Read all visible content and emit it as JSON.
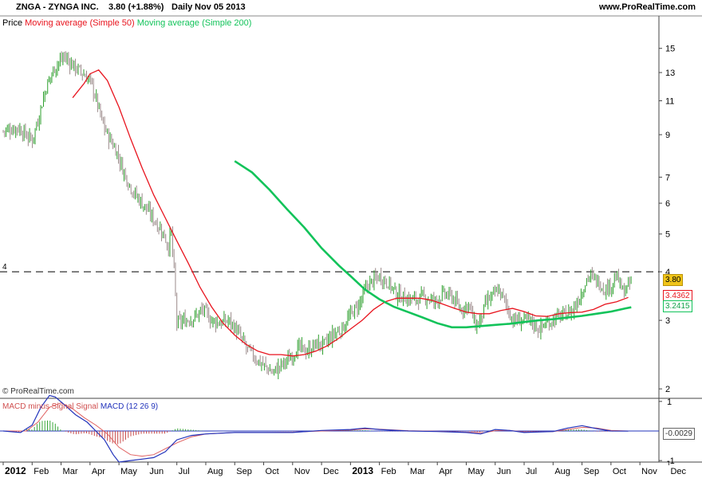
{
  "header": {
    "symbol_text": "ZNGA - ZYNGA INC.",
    "quote_text": "3.80 (+1.88%)",
    "period_text": "Daily",
    "date_text": "Nov 05 2013",
    "site_text": "www.ProRealTime.com"
  },
  "legend": {
    "price": "Price",
    "ma50": "Moving average (Simple 50)",
    "ma200": "Moving average (Simple 200)"
  },
  "macd_legend": {
    "histogram": "MACD minus Signal",
    "signal": "Signal",
    "macd": "MACD (12 26 9)"
  },
  "copyright": "© ProRealTime.com",
  "colors": {
    "up": "#2ea02e",
    "down": "#9b8a8a",
    "ma50": "#e8141e",
    "ma200": "#12c35a",
    "macd": "#2233bb",
    "signal": "#e06060",
    "price_badge": "#f0c419",
    "axis": "#444444"
  },
  "chart_data": [
    {
      "type": "candlestick",
      "title": "ZNGA - ZYNGA INC.",
      "scale": "log",
      "ylim": [
        1.9,
        17.5
      ],
      "y_ticks": [
        2,
        3,
        4,
        5,
        6,
        7,
        9,
        11,
        13,
        15
      ],
      "x_ticks": [
        "2012",
        "Feb",
        "Mar",
        "Apr",
        "May",
        "Jun",
        "Jul",
        "Aug",
        "Sep",
        "Oct",
        "Nov",
        "Dec",
        "2013",
        "Feb",
        "Mar",
        "Apr",
        "May",
        "Jun",
        "Jul",
        "Aug",
        "Sep",
        "Oct",
        "Nov",
        "Dec"
      ],
      "reference_line": {
        "value": 4,
        "label": "4",
        "style": "dashed"
      },
      "last_values": {
        "price": "3.80",
        "ma50": "3.4362",
        "ma200": "3.2415"
      },
      "price_path": [
        [
          0,
          9.2
        ],
        [
          0.5,
          9.4
        ],
        [
          1,
          8.7
        ],
        [
          1.2,
          9.8
        ],
        [
          1.5,
          12.0
        ],
        [
          1.8,
          13.5
        ],
        [
          2.1,
          14.3
        ],
        [
          2.4,
          13.6
        ],
        [
          2.7,
          13.0
        ],
        [
          3.0,
          12.4
        ],
        [
          3.2,
          11.2
        ],
        [
          3.4,
          9.8
        ],
        [
          3.6,
          9.0
        ],
        [
          3.9,
          8.2
        ],
        [
          4.2,
          7.1
        ],
        [
          4.5,
          6.4
        ],
        [
          4.8,
          6.0
        ],
        [
          5.1,
          5.6
        ],
        [
          5.4,
          5.2
        ],
        [
          5.6,
          4.9
        ],
        [
          5.7,
          4.6
        ],
        [
          5.8,
          5.1
        ],
        [
          6.0,
          2.95
        ],
        [
          6.3,
          3.0
        ],
        [
          6.6,
          3.05
        ],
        [
          6.9,
          3.2
        ],
        [
          7.2,
          3.0
        ],
        [
          7.5,
          2.95
        ],
        [
          7.8,
          3.0
        ],
        [
          8.1,
          2.8
        ],
        [
          8.4,
          2.55
        ],
        [
          8.7,
          2.4
        ],
        [
          9.0,
          2.3
        ],
        [
          9.3,
          2.2
        ],
        [
          9.6,
          2.3
        ],
        [
          9.9,
          2.4
        ],
        [
          10.2,
          2.55
        ],
        [
          10.5,
          2.5
        ],
        [
          10.8,
          2.6
        ],
        [
          11.1,
          2.6
        ],
        [
          11.4,
          2.75
        ],
        [
          11.7,
          2.85
        ],
        [
          12.0,
          3.1
        ],
        [
          12.3,
          3.3
        ],
        [
          12.6,
          3.7
        ],
        [
          12.8,
          3.8
        ],
        [
          13.0,
          3.9
        ],
        [
          13.3,
          3.75
        ],
        [
          13.6,
          3.5
        ],
        [
          14.0,
          3.4
        ],
        [
          14.3,
          3.4
        ],
        [
          14.6,
          3.45
        ],
        [
          14.9,
          3.35
        ],
        [
          15.2,
          3.5
        ],
        [
          15.5,
          3.45
        ],
        [
          15.8,
          3.2
        ],
        [
          16.1,
          3.3
        ],
        [
          16.3,
          2.9
        ],
        [
          16.5,
          3.0
        ],
        [
          16.7,
          3.35
        ],
        [
          16.9,
          3.45
        ],
        [
          17.1,
          3.6
        ],
        [
          17.3,
          3.4
        ],
        [
          17.6,
          3.0
        ],
        [
          17.9,
          3.0
        ],
        [
          18.2,
          3.0
        ],
        [
          18.5,
          2.85
        ],
        [
          18.8,
          2.95
        ],
        [
          19.1,
          3.05
        ],
        [
          19.4,
          3.1
        ],
        [
          19.7,
          3.2
        ],
        [
          20.0,
          3.55
        ],
        [
          20.2,
          3.9
        ],
        [
          20.4,
          3.85
        ],
        [
          20.6,
          3.75
        ],
        [
          20.8,
          3.6
        ],
        [
          21.0,
          3.7
        ],
        [
          21.2,
          3.9
        ],
        [
          21.4,
          3.55
        ],
        [
          21.6,
          3.65
        ],
        [
          21.7,
          3.8
        ]
      ],
      "ma50": [
        [
          2.4,
          11.2
        ],
        [
          2.8,
          12.2
        ],
        [
          3.0,
          12.9
        ],
        [
          3.3,
          13.2
        ],
        [
          3.6,
          12.4
        ],
        [
          4.0,
          10.6
        ],
        [
          4.4,
          8.8
        ],
        [
          4.8,
          7.4
        ],
        [
          5.2,
          6.3
        ],
        [
          5.6,
          5.5
        ],
        [
          6.0,
          4.8
        ],
        [
          6.4,
          4.2
        ],
        [
          6.8,
          3.65
        ],
        [
          7.2,
          3.25
        ],
        [
          7.6,
          2.95
        ],
        [
          8.0,
          2.75
        ],
        [
          8.4,
          2.6
        ],
        [
          8.8,
          2.5
        ],
        [
          9.2,
          2.45
        ],
        [
          9.6,
          2.45
        ],
        [
          10.0,
          2.43
        ],
        [
          10.4,
          2.45
        ],
        [
          10.8,
          2.5
        ],
        [
          11.2,
          2.58
        ],
        [
          11.6,
          2.7
        ],
        [
          12.0,
          2.85
        ],
        [
          12.4,
          3.0
        ],
        [
          12.8,
          3.2
        ],
        [
          13.2,
          3.35
        ],
        [
          13.6,
          3.42
        ],
        [
          14.0,
          3.42
        ],
        [
          14.4,
          3.42
        ],
        [
          14.8,
          3.38
        ],
        [
          15.2,
          3.3
        ],
        [
          15.6,
          3.22
        ],
        [
          16.0,
          3.15
        ],
        [
          16.4,
          3.12
        ],
        [
          16.8,
          3.12
        ],
        [
          17.2,
          3.18
        ],
        [
          17.6,
          3.22
        ],
        [
          18.0,
          3.16
        ],
        [
          18.4,
          3.08
        ],
        [
          18.8,
          3.07
        ],
        [
          19.2,
          3.12
        ],
        [
          19.6,
          3.14
        ],
        [
          20.0,
          3.15
        ],
        [
          20.4,
          3.2
        ],
        [
          20.8,
          3.3
        ],
        [
          21.2,
          3.35
        ],
        [
          21.6,
          3.4362
        ]
      ],
      "ma200": [
        [
          8.0,
          7.7
        ],
        [
          8.6,
          7.2
        ],
        [
          9.2,
          6.5
        ],
        [
          9.8,
          5.8
        ],
        [
          10.4,
          5.2
        ],
        [
          11.0,
          4.6
        ],
        [
          11.6,
          4.15
        ],
        [
          12.0,
          3.9
        ],
        [
          12.5,
          3.6
        ],
        [
          13.0,
          3.4
        ],
        [
          13.5,
          3.25
        ],
        [
          14.0,
          3.15
        ],
        [
          14.5,
          3.05
        ],
        [
          15.0,
          2.95
        ],
        [
          15.5,
          2.88
        ],
        [
          16.0,
          2.88
        ],
        [
          16.5,
          2.9
        ],
        [
          17.0,
          2.92
        ],
        [
          17.5,
          2.94
        ],
        [
          18.0,
          2.97
        ],
        [
          18.5,
          3.0
        ],
        [
          19.0,
          3.02
        ],
        [
          19.5,
          3.05
        ],
        [
          20.0,
          3.08
        ],
        [
          20.5,
          3.12
        ],
        [
          21.0,
          3.16
        ],
        [
          21.5,
          3.22
        ],
        [
          21.7,
          3.2415
        ]
      ]
    },
    {
      "type": "line",
      "title": "MACD (12 26 9)",
      "ylim": [
        -1.05,
        1.05
      ],
      "y_ticks": [
        1,
        -1
      ],
      "last_value": "-0.0029",
      "macd": [
        [
          0,
          0.0
        ],
        [
          0.6,
          -0.05
        ],
        [
          1.0,
          0.2
        ],
        [
          1.3,
          0.8
        ],
        [
          1.6,
          1.2
        ],
        [
          1.8,
          1.15
        ],
        [
          2.1,
          0.9
        ],
        [
          2.5,
          0.55
        ],
        [
          2.9,
          0.3
        ],
        [
          3.2,
          0.0
        ],
        [
          3.5,
          -0.3
        ],
        [
          3.8,
          -0.8
        ],
        [
          4.0,
          -1.05
        ],
        [
          4.4,
          -1.0
        ],
        [
          4.8,
          -0.95
        ],
        [
          5.2,
          -0.9
        ],
        [
          5.6,
          -0.7
        ],
        [
          6.0,
          -0.3
        ],
        [
          6.5,
          -0.15
        ],
        [
          7.0,
          -0.1
        ],
        [
          8.0,
          -0.05
        ],
        [
          9.0,
          -0.05
        ],
        [
          10.0,
          -0.05
        ],
        [
          11.0,
          0.02
        ],
        [
          12.0,
          0.05
        ],
        [
          12.5,
          0.1
        ],
        [
          13.0,
          0.05
        ],
        [
          14.0,
          0.0
        ],
        [
          15.0,
          -0.02
        ],
        [
          16.0,
          -0.05
        ],
        [
          16.5,
          -0.1
        ],
        [
          17.0,
          0.05
        ],
        [
          17.5,
          0.02
        ],
        [
          18.0,
          -0.05
        ],
        [
          19.0,
          -0.02
        ],
        [
          19.5,
          0.1
        ],
        [
          20.0,
          0.18
        ],
        [
          20.5,
          0.08
        ],
        [
          21.0,
          0.0
        ],
        [
          21.6,
          -0.0029
        ]
      ],
      "signal": [
        [
          0,
          0.0
        ],
        [
          0.8,
          0.0
        ],
        [
          1.2,
          0.3
        ],
        [
          1.6,
          0.8
        ],
        [
          2.0,
          0.95
        ],
        [
          2.4,
          0.75
        ],
        [
          2.8,
          0.45
        ],
        [
          3.2,
          0.2
        ],
        [
          3.6,
          -0.1
        ],
        [
          4.0,
          -0.55
        ],
        [
          4.4,
          -0.8
        ],
        [
          4.8,
          -0.85
        ],
        [
          5.2,
          -0.8
        ],
        [
          5.6,
          -0.6
        ],
        [
          6.0,
          -0.4
        ],
        [
          6.5,
          -0.2
        ],
        [
          7.0,
          -0.1
        ],
        [
          8.0,
          -0.05
        ],
        [
          9.0,
          -0.05
        ],
        [
          10.0,
          -0.04
        ],
        [
          11.0,
          0.0
        ],
        [
          12.0,
          0.03
        ],
        [
          12.5,
          0.07
        ],
        [
          13.0,
          0.06
        ],
        [
          14.0,
          0.01
        ],
        [
          15.0,
          -0.01
        ],
        [
          16.0,
          -0.04
        ],
        [
          16.6,
          -0.06
        ],
        [
          17.0,
          0.01
        ],
        [
          17.5,
          0.02
        ],
        [
          18.0,
          -0.03
        ],
        [
          19.0,
          -0.02
        ],
        [
          19.5,
          0.05
        ],
        [
          20.0,
          0.12
        ],
        [
          20.5,
          0.1
        ],
        [
          21.0,
          0.02
        ],
        [
          21.6,
          0.0
        ]
      ]
    }
  ]
}
